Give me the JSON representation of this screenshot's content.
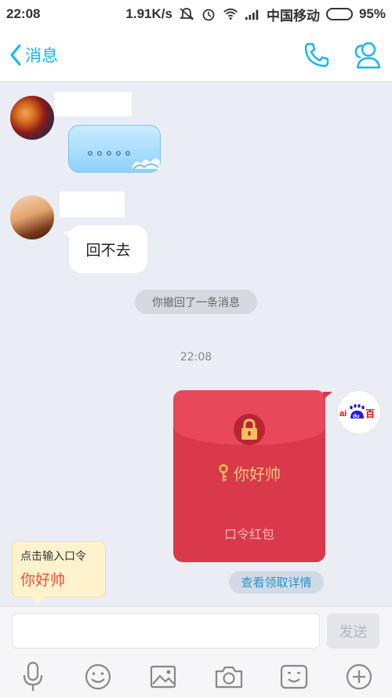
{
  "status_bar": {
    "time": "22:08",
    "speed": "1.91K/s",
    "carrier": "中国移动",
    "battery": "95%",
    "battery_level": 0.95
  },
  "header": {
    "back_label": "消息"
  },
  "messages": {
    "msg1_text": "。。。。。",
    "msg2_text": "回不去",
    "recall_notice": "你撤回了一条消息",
    "timestamp": "22:08"
  },
  "red_packet": {
    "message": "你好帅",
    "title": "口令红包",
    "details_button": "查看领取详情"
  },
  "password_hint": {
    "label": "点击输入口令",
    "value": "你好帅"
  },
  "input_bar": {
    "value": "",
    "send_label": "发送"
  },
  "colors": {
    "accent": "#12b7f5",
    "red_packet": "#d9394a",
    "hint_text": "#f04d3d"
  }
}
